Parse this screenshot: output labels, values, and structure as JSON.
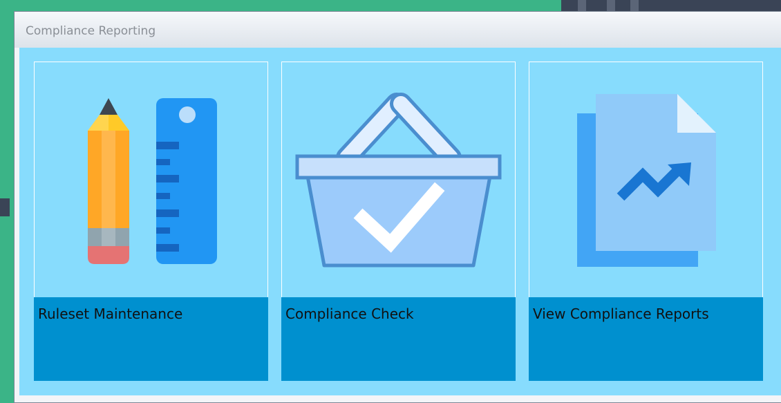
{
  "window": {
    "title": "Compliance Reporting"
  },
  "tiles": [
    {
      "label": "Ruleset Maintenance",
      "icon": "pencil-ruler-icon"
    },
    {
      "label": "Compliance Check",
      "icon": "basket-check-icon"
    },
    {
      "label": "View Compliance Reports",
      "icon": "report-trend-icon"
    }
  ],
  "colors": {
    "desktop": "#3bb487",
    "panel": "#87dcfd",
    "caption": "#0090cf",
    "icon_blue": "#2196f3"
  }
}
